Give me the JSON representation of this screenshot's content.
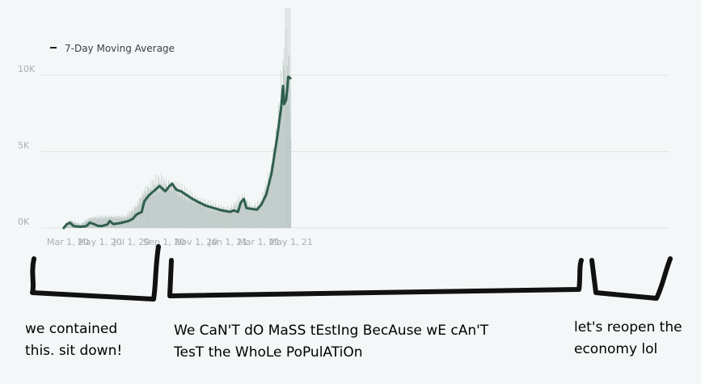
{
  "chart_data": {
    "type": "bar",
    "legend": {
      "label": "7-Day Moving Average",
      "position": "top-left"
    },
    "x_tick_labels": [
      "Mar 1, 20",
      "May 1, 20",
      "Jul 1, 20",
      "Sep 1, 20",
      "Nov 1, 20",
      "Jan 1, 21",
      "Mar 1, 21",
      "May 1, 21"
    ],
    "y_tick_labels": [
      "0K",
      "5K",
      "10K"
    ],
    "ylim": [
      0,
      10000
    ],
    "grid": "horizontal",
    "shaded_region": {
      "start": "2021-04-19",
      "end": "2021-05-01"
    },
    "colors": {
      "line": "#2f5f4e",
      "bars": "#b9c5c3",
      "grid": "#e1e6e6",
      "shade": "#e0e5e5"
    },
    "moving_average": [
      [
        "2020-02-22",
        0
      ],
      [
        "2020-02-28",
        250
      ],
      [
        "2020-03-05",
        350
      ],
      [
        "2020-03-12",
        120
      ],
      [
        "2020-03-25",
        80
      ],
      [
        "2020-04-05",
        120
      ],
      [
        "2020-04-12",
        350
      ],
      [
        "2020-04-20",
        250
      ],
      [
        "2020-04-28",
        130
      ],
      [
        "2020-05-05",
        130
      ],
      [
        "2020-05-15",
        220
      ],
      [
        "2020-05-20",
        450
      ],
      [
        "2020-05-27",
        250
      ],
      [
        "2020-06-10",
        330
      ],
      [
        "2020-06-25",
        460
      ],
      [
        "2020-07-03",
        600
      ],
      [
        "2020-07-10",
        880
      ],
      [
        "2020-07-20",
        1050
      ],
      [
        "2020-07-25",
        1750
      ],
      [
        "2020-08-03",
        2150
      ],
      [
        "2020-08-15",
        2500
      ],
      [
        "2020-08-23",
        2750
      ],
      [
        "2020-09-03",
        2400
      ],
      [
        "2020-09-10",
        2700
      ],
      [
        "2020-09-16",
        2900
      ],
      [
        "2020-09-24",
        2500
      ],
      [
        "2020-10-03",
        2400
      ],
      [
        "2020-10-14",
        2150
      ],
      [
        "2020-10-25",
        1900
      ],
      [
        "2020-11-05",
        1700
      ],
      [
        "2020-11-20",
        1450
      ],
      [
        "2020-12-05",
        1300
      ],
      [
        "2020-12-20",
        1150
      ],
      [
        "2021-01-05",
        1050
      ],
      [
        "2021-01-12",
        1150
      ],
      [
        "2021-01-20",
        1050
      ],
      [
        "2021-01-25",
        1650
      ],
      [
        "2021-01-31",
        1900
      ],
      [
        "2021-02-05",
        1300
      ],
      [
        "2021-02-15",
        1250
      ],
      [
        "2021-02-25",
        1200
      ],
      [
        "2021-03-05",
        1500
      ],
      [
        "2021-03-15",
        2200
      ],
      [
        "2021-03-25",
        3600
      ],
      [
        "2021-04-05",
        6000
      ],
      [
        "2021-04-12",
        7800
      ],
      [
        "2021-04-16",
        9300
      ],
      [
        "2021-04-18",
        8100
      ],
      [
        "2021-04-22",
        8400
      ],
      [
        "2021-04-26",
        9900
      ],
      [
        "2021-04-30",
        9800
      ]
    ],
    "daily_bar_envelope": [
      [
        "2020-02-22",
        0
      ],
      [
        "2020-03-05",
        600
      ],
      [
        "2020-03-25",
        300
      ],
      [
        "2020-04-12",
        800
      ],
      [
        "2020-05-20",
        900
      ],
      [
        "2020-06-20",
        900
      ],
      [
        "2020-07-10",
        1700
      ],
      [
        "2020-07-25",
        2900
      ],
      [
        "2020-08-23",
        3700
      ],
      [
        "2020-09-16",
        3400
      ],
      [
        "2020-10-14",
        2700
      ],
      [
        "2020-11-05",
        2200
      ],
      [
        "2020-12-05",
        1700
      ],
      [
        "2021-01-05",
        1500
      ],
      [
        "2021-01-31",
        2400
      ],
      [
        "2021-02-15",
        1600
      ],
      [
        "2021-03-05",
        2000
      ],
      [
        "2021-03-25",
        4600
      ],
      [
        "2021-04-05",
        8200
      ],
      [
        "2021-04-16",
        12500
      ],
      [
        "2021-04-22",
        13200
      ],
      [
        "2021-04-30",
        11500
      ],
      [
        "2021-05-01",
        8000
      ]
    ]
  },
  "annotations": [
    {
      "lines": [
        "we contained",
        "this. sit down!"
      ]
    },
    {
      "lines": [
        "We CaN'T dO MaSS tEstIng BecAuse wE cAn'T",
        "TesT the WhoLe PoPulATiOn"
      ]
    },
    {
      "lines": [
        "let's reopen the",
        "economy lol"
      ]
    }
  ]
}
